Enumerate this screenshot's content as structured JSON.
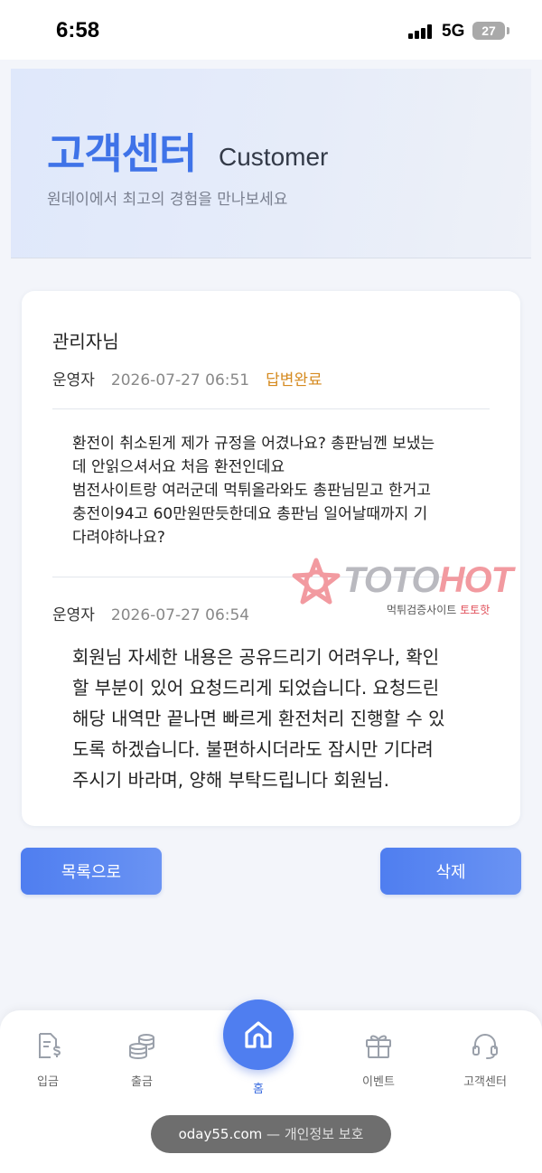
{
  "status_bar": {
    "time": "6:58",
    "network": "5G",
    "battery": "27"
  },
  "hero": {
    "title": "고객센터",
    "subtitle": "Customer",
    "description": "원데이에서 최고의 경험을 만나보세요"
  },
  "post": {
    "title": "관리자님",
    "question": {
      "author": "운영자",
      "date": "2026-07-27 06:51",
      "status": "답변완료",
      "body": "환전이 취소된게 제가 규정을 어겼나요? 총판님껜 보냈는\n데 안읽으셔서요 처음 환전인데요\n범전사이트랑 여러군데 먹튀올라와도 총판님믿고 한거고\n충전이94고 60만원딴듯한데요 총판님 일어날때까지 기\n다려야하나요?"
    },
    "answer": {
      "author": "운영자",
      "date": "2026-07-27 06:54",
      "body": "회원님 자세한 내용은 공유드리기 어려우나, 확인\n할 부분이 있어 요청드리게 되었습니다. 요청드린\n해당 내역만 끝나면 빠르게 환전처리 진행할 수 있\n도록 하겠습니다. 불편하시더라도 잠시만 기다려\n주시기 바라며, 양해 부탁드립니다 회원님."
    }
  },
  "watermark": {
    "brand_a": "TOTO",
    "brand_b": "HOT",
    "tagline_a": "먹튀검증사이트",
    "tagline_b": "토토핫"
  },
  "buttons": {
    "list": "목록으로",
    "delete": "삭제"
  },
  "nav": {
    "items": [
      {
        "label": "입금",
        "icon": "deposit-icon"
      },
      {
        "label": "출금",
        "icon": "coins-icon"
      },
      {
        "label": "홈",
        "icon": "home-icon"
      },
      {
        "label": "이벤트",
        "icon": "gift-icon"
      },
      {
        "label": "고객센터",
        "icon": "headset-icon"
      }
    ]
  },
  "url_bar": {
    "domain": "oday55.com",
    "suffix": "— 개인정보 보호"
  },
  "colors": {
    "accent": "#4f7ef0",
    "status_done": "#d58a1f"
  }
}
